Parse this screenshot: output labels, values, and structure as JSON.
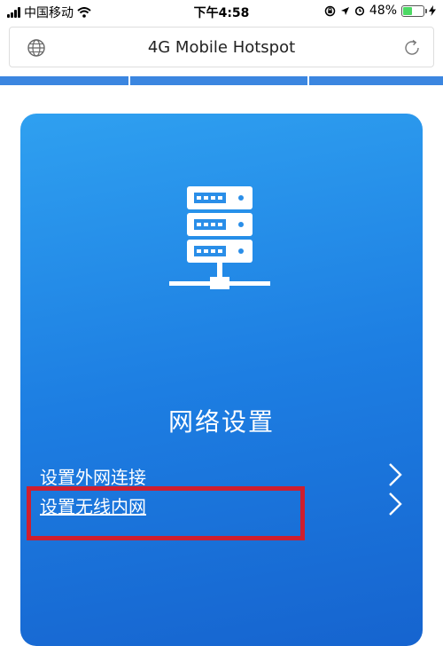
{
  "status_bar": {
    "carrier": "中国移动",
    "time": "下午4:58",
    "battery": "48%",
    "battery_level": 0.48
  },
  "browser": {
    "page_title": "4G Mobile Hotspot",
    "globe_icon": "globe-icon",
    "reload_icon": "reload-icon"
  },
  "card": {
    "icon": "server-network-icon",
    "title": "网络设置",
    "items": [
      {
        "label": "设置外网连接",
        "icon": "chevron-right-icon"
      },
      {
        "label": "设置无线内网",
        "icon": "chevron-right-icon"
      }
    ]
  },
  "colors": {
    "card_top": "#2fa0f0",
    "card_bottom": "#1664cf",
    "tab_blue": "#3b86e0",
    "highlight_red": "#cf1e2e"
  }
}
